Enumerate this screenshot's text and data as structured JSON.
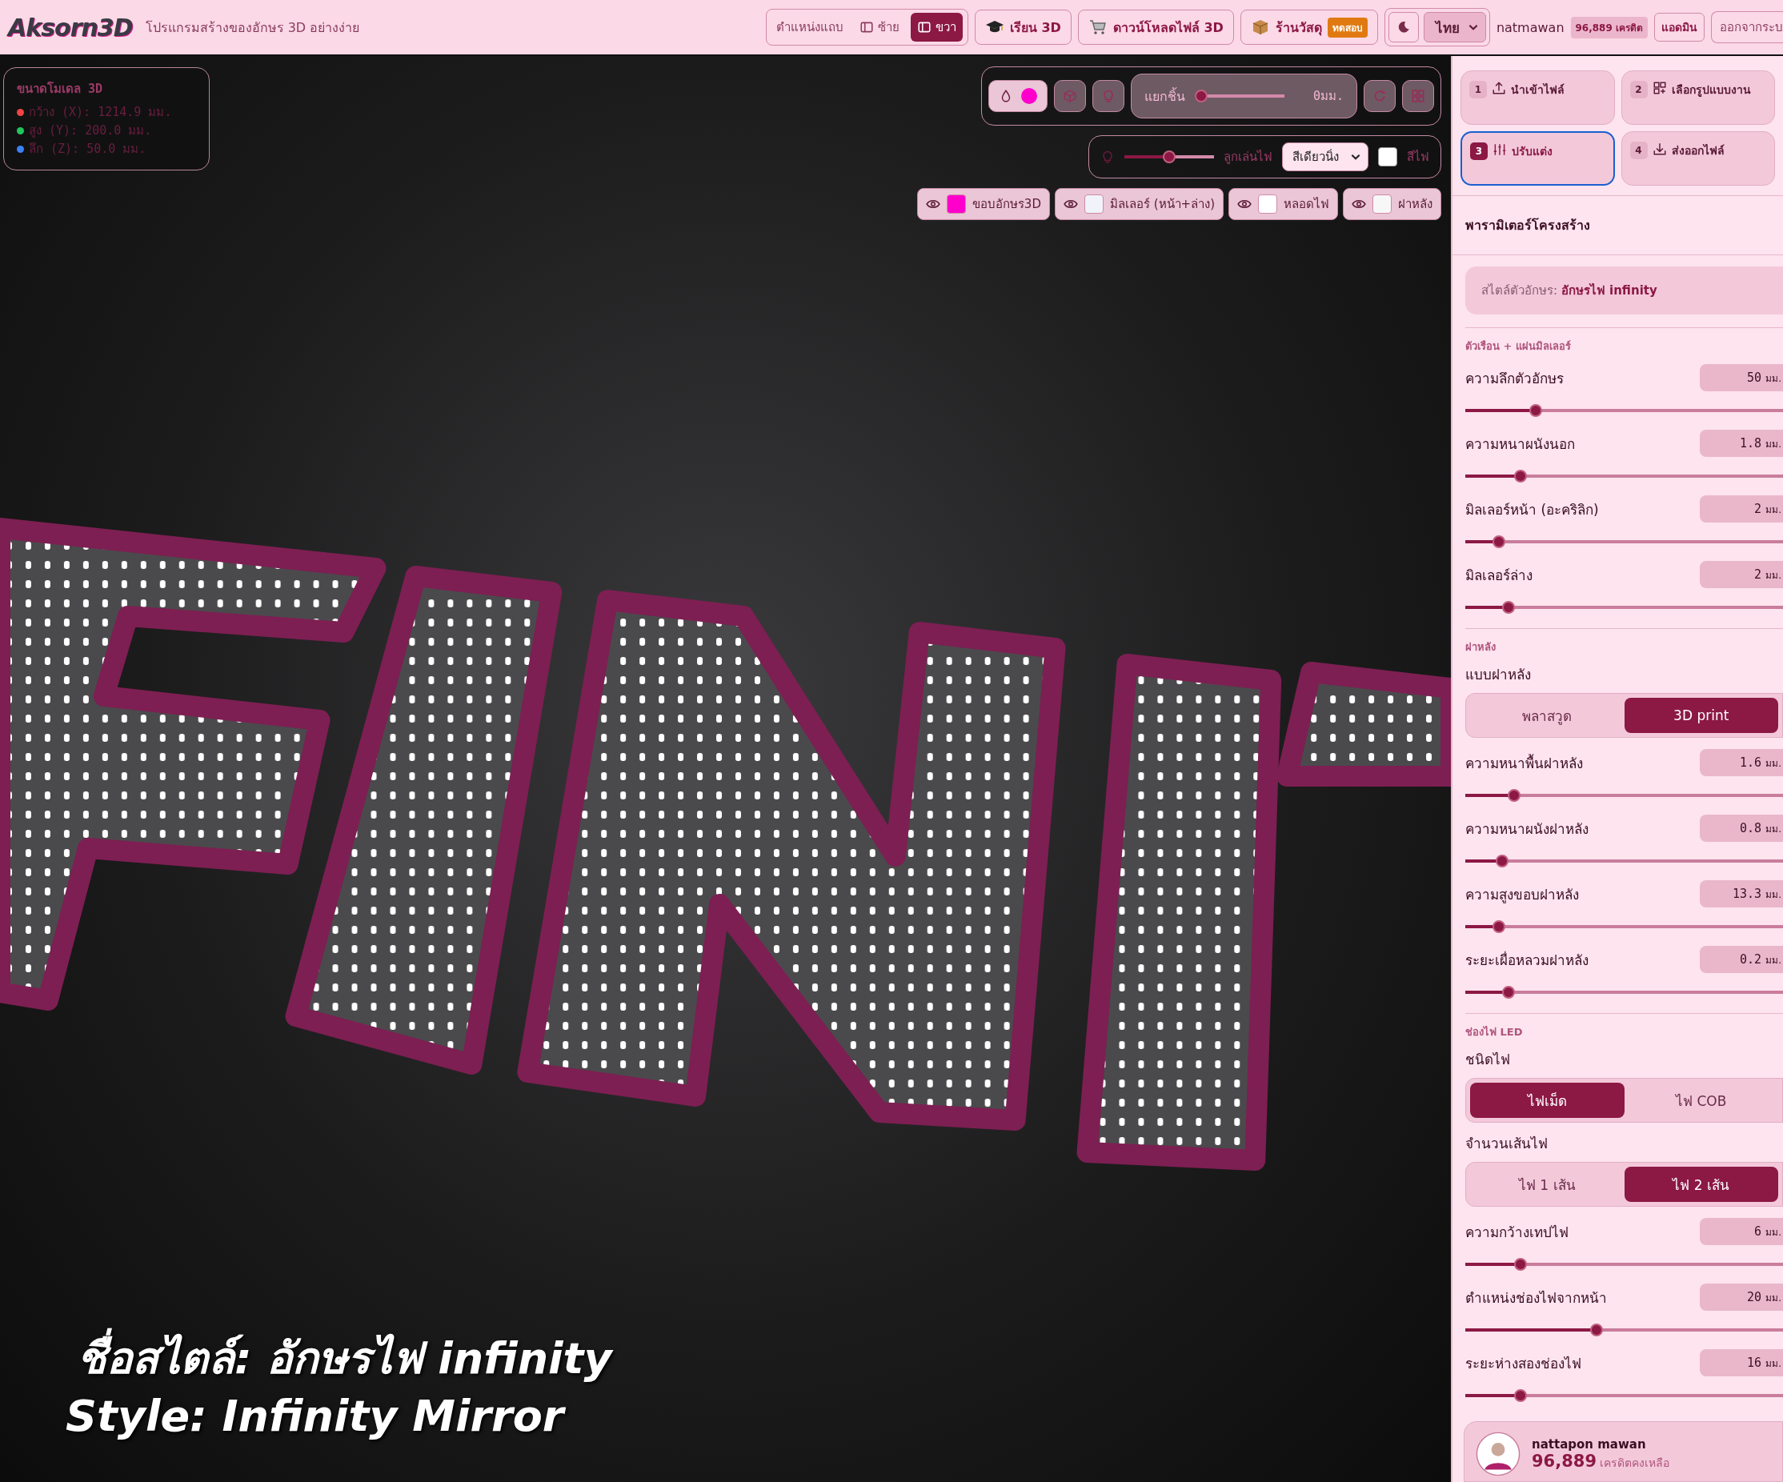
{
  "header": {
    "logo": "Aksorn3D",
    "subtitle": "โปรแกรมสร้างของอักษร 3D อย่างง่าย",
    "dock": {
      "label": "ตำแหน่งแถบ",
      "options": [
        {
          "label": "ซ้าย",
          "selected": false
        },
        {
          "label": "ขวา",
          "selected": true
        }
      ]
    },
    "nav": [
      {
        "kind": "learn",
        "label": "เรียน 3D"
      },
      {
        "kind": "download",
        "label": "ดาวน์โหลดไฟล์ 3D"
      },
      {
        "kind": "shop",
        "label": "ร้านวัสดุ",
        "badge": "ทดสอบ"
      }
    ],
    "language": "ไทย",
    "user": "natmawan",
    "credits": "96,889 เครดิต",
    "admin": "แอดมิน",
    "logout": "ออกจากระบ"
  },
  "viewport": {
    "dimensions": {
      "title": "ขนาดโมเดล 3D",
      "rows": [
        {
          "text": "กว้าง (X): 1214.9 มม.",
          "color": "#ef4444"
        },
        {
          "text": "สูง (Y): 200.0 มม.",
          "color": "#22c55e"
        },
        {
          "text": "ลึก (Z): 50.0 มม.",
          "color": "#3b82f6"
        }
      ]
    },
    "toolbar": {
      "explode": {
        "label": "แยกชิ้น",
        "level": 0,
        "reading": "0มม."
      }
    },
    "lighting": {
      "level": 0.5,
      "label": "ลูกเล่นไฟ",
      "effect": "สีเดียวนิ่ง",
      "color_label": "สีไฟ"
    },
    "layers": [
      {
        "label": "ขอบอักษร3D",
        "color": "#ff00cc"
      },
      {
        "label": "มิลเลอร์ (หน้า+ล่าง)",
        "color": "#f0f4fa"
      },
      {
        "label": "หลอดไฟ",
        "color": "#ffffff"
      },
      {
        "label": "ฝาหลัง",
        "color": "#f7f7f7"
      }
    ],
    "caption": [
      "ชื่อสไตล์: อักษรไฟ infinity",
      "Style: Infinity Mirror"
    ]
  },
  "panel": {
    "steps": [
      {
        "number": "1",
        "kind": "upload",
        "label": "นำเข้าไฟล์",
        "selected": false
      },
      {
        "number": "2",
        "kind": "layout",
        "label": "เลือกรูปแบบงาน",
        "selected": false
      },
      {
        "number": "3",
        "kind": "adjust",
        "label": "ปรับแต่ง",
        "selected": true
      },
      {
        "number": "4",
        "kind": "export",
        "label": "ส่งออกไฟล์",
        "selected": false
      }
    ],
    "title": "พารามิเตอร์โครงสร้าง",
    "style_note": "สไตล์ตัวอักษร: **อักษรไฟ infinity**",
    "groups": [
      {
        "title": "ตัวเรือน + แผ่นมิลเลอร์",
        "items": [
          {
            "kind": "slider",
            "label": "ความลึกตัวอักษร",
            "value": "50",
            "unit": "มม.",
            "level": 0.21
          },
          {
            "kind": "slider",
            "label": "ความหนาผนังนอก",
            "value": "1.8",
            "unit": "มม.",
            "level": 0.16
          },
          {
            "kind": "slider",
            "label": "มิลเลอร์หน้า (อะคริลิก)",
            "value": "2",
            "unit": "มม.",
            "level": 0.09
          },
          {
            "kind": "slider",
            "label": "มิลเลอร์ล่าง",
            "value": "2",
            "unit": "มม.",
            "level": 0.12
          }
        ]
      },
      {
        "title": "ฝาหลัง",
        "items": [
          {
            "kind": "segmented",
            "label": "แบบฝาหลัง",
            "options": [
              {
                "label": "พลาสวูด",
                "selected": false
              },
              {
                "label": "3D print",
                "selected": true
              }
            ]
          },
          {
            "kind": "slider",
            "label": "ความหนาพื้นฝาหลัง",
            "value": "1.6",
            "unit": "มม.",
            "level": 0.14
          },
          {
            "kind": "slider",
            "label": "ความหนาผนังฝาหลัง",
            "value": "0.8",
            "unit": "มม.",
            "level": 0.1
          },
          {
            "kind": "slider",
            "label": "ความสูงขอบฝาหลัง",
            "value": "13.3",
            "unit": "มม.",
            "level": 0.09
          },
          {
            "kind": "slider",
            "label": "ระยะเผื่อหลวมฝาหลัง",
            "value": "0.2",
            "unit": "มม.",
            "level": 0.12
          }
        ]
      },
      {
        "title": "ช่องไฟ LED",
        "items": [
          {
            "kind": "segmented",
            "label": "ชนิดไฟ",
            "options": [
              {
                "label": "ไฟเม็ด",
                "selected": true
              },
              {
                "label": "ไฟ COB",
                "selected": false
              }
            ]
          },
          {
            "kind": "segmented",
            "label": "จำนวนเส้นไฟ",
            "options": [
              {
                "label": "ไฟ 1 เส้น",
                "selected": false
              },
              {
                "label": "ไฟ 2 เส้น",
                "selected": true
              }
            ]
          },
          {
            "kind": "slider",
            "label": "ความกว้างเทปไฟ",
            "value": "6",
            "unit": "มม.",
            "level": 0.16
          },
          {
            "kind": "slider",
            "label": "ตำแหน่งช่องไฟจากหน้า",
            "value": "20",
            "unit": "มม.",
            "level": 0.41
          },
          {
            "kind": "slider",
            "label": "ระยะห่างสองช่องไฟ",
            "value": "16",
            "unit": "มม.",
            "level": 0.16
          }
        ]
      }
    ],
    "account": {
      "name": "nattapon mawan",
      "credits": "96,889",
      "credits_label": "เครดิตคงเหลือ"
    }
  }
}
